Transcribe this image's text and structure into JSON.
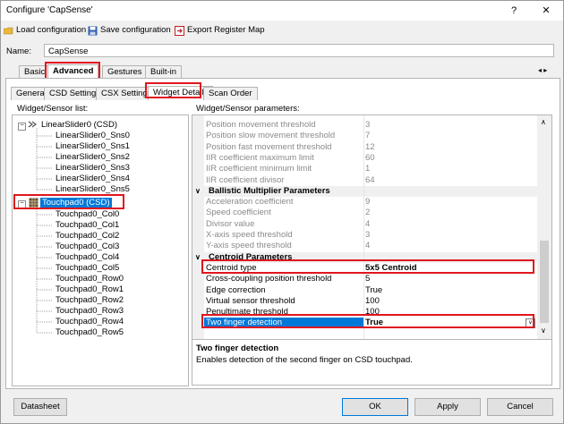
{
  "window": {
    "title": "Configure 'CapSense'",
    "help_label": "?",
    "close_label": "✕"
  },
  "toolbar": {
    "load": "Load configuration",
    "save": "Save configuration",
    "export": "Export Register Map"
  },
  "name": {
    "label": "Name:",
    "value": "CapSense"
  },
  "main_tabs": [
    "Basic",
    "Advanced",
    "Gestures",
    "Built-in"
  ],
  "main_tab_selected": "Advanced",
  "scroll_arrows": "◂ ▸",
  "sub_tabs": [
    "General",
    "CSD Settings",
    "CSX Settings",
    "Widget Details",
    "Scan Order"
  ],
  "sub_tab_selected": "Widget Details",
  "widget_list": {
    "header": "Widget/Sensor list:",
    "items": [
      {
        "label": "LinearSlider0 (CSD)",
        "level": 0,
        "selected": false
      },
      {
        "label": "LinearSlider0_Sns0",
        "level": 1
      },
      {
        "label": "LinearSlider0_Sns1",
        "level": 1
      },
      {
        "label": "LinearSlider0_Sns2",
        "level": 1
      },
      {
        "label": "LinearSlider0_Sns3",
        "level": 1
      },
      {
        "label": "LinearSlider0_Sns4",
        "level": 1
      },
      {
        "label": "LinearSlider0_Sns5",
        "level": 1
      },
      {
        "label": "Touchpad0 (CSD)",
        "level": 0,
        "selected": true
      },
      {
        "label": "Touchpad0_Col0",
        "level": 1
      },
      {
        "label": "Touchpad0_Col1",
        "level": 1
      },
      {
        "label": "Touchpad0_Col2",
        "level": 1
      },
      {
        "label": "Touchpad0_Col3",
        "level": 1
      },
      {
        "label": "Touchpad0_Col4",
        "level": 1
      },
      {
        "label": "Touchpad0_Col5",
        "level": 1
      },
      {
        "label": "Touchpad0_Row0",
        "level": 1
      },
      {
        "label": "Touchpad0_Row1",
        "level": 1
      },
      {
        "label": "Touchpad0_Row2",
        "level": 1
      },
      {
        "label": "Touchpad0_Row3",
        "level": 1
      },
      {
        "label": "Touchpad0_Row4",
        "level": 1
      },
      {
        "label": "Touchpad0_Row5",
        "level": 1
      }
    ]
  },
  "params": {
    "header": "Widget/Sensor parameters:",
    "rows": [
      {
        "k": "Position movement threshold",
        "v": "3",
        "grey": true
      },
      {
        "k": "Position slow movement threshold",
        "v": "7",
        "grey": true
      },
      {
        "k": "Position fast movement threshold",
        "v": "12",
        "grey": true
      },
      {
        "k": "IIR coefficient maximum limit",
        "v": "60",
        "grey": true
      },
      {
        "k": "IIR coefficient minimum limit",
        "v": "1",
        "grey": true
      },
      {
        "k": "IIR coefficient divisor",
        "v": "64",
        "grey": true
      },
      {
        "k": "Ballistic Multiplier Parameters",
        "v": "",
        "cat": true
      },
      {
        "k": "Acceleration coefficient",
        "v": "9",
        "grey": true
      },
      {
        "k": "Speed coefficient",
        "v": "2",
        "grey": true
      },
      {
        "k": "Divisor value",
        "v": "4",
        "grey": true
      },
      {
        "k": "X-axis speed threshold",
        "v": "3",
        "grey": true
      },
      {
        "k": "Y-axis speed threshold",
        "v": "4",
        "grey": true
      },
      {
        "k": "Centroid Parameters",
        "v": "",
        "cat": true
      },
      {
        "k": "Centroid type",
        "v": "5x5 Centroid",
        "bold": true
      },
      {
        "k": "Cross-coupling position threshold",
        "v": "5"
      },
      {
        "k": "Edge correction",
        "v": "True"
      },
      {
        "k": "Virtual sensor threshold",
        "v": "100"
      },
      {
        "k": "Penultimate threshold",
        "v": "100"
      },
      {
        "k": "Two finger detection",
        "v": "True",
        "selected": true,
        "bold": true
      }
    ]
  },
  "description": {
    "title": "Two finger detection",
    "text": "Enables detection of the second finger on CSD touchpad."
  },
  "buttons": {
    "datasheet": "Datasheet",
    "ok": "OK",
    "apply": "Apply",
    "cancel": "Cancel"
  }
}
